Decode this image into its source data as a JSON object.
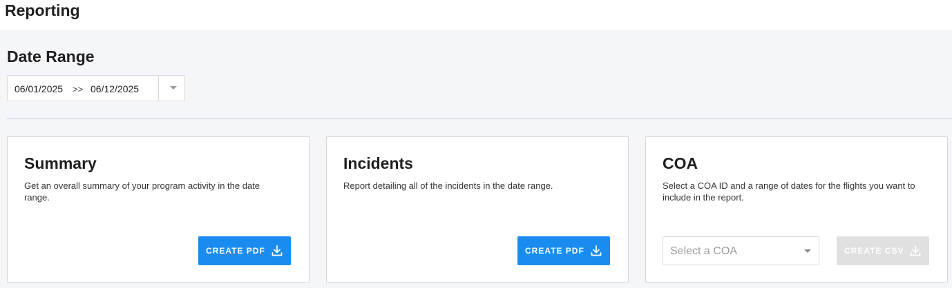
{
  "header": {
    "title": "Reporting"
  },
  "date_range": {
    "title": "Date Range",
    "start": "06/01/2025",
    "separator": ">>",
    "end": "06/12/2025"
  },
  "cards": [
    {
      "title": "Summary",
      "description": "Get an overall summary of your program activity in the date range.",
      "button_label": "CREATE PDF"
    },
    {
      "title": "Incidents",
      "description": "Report detailing all of the incidents in the date range.",
      "button_label": "CREATE PDF"
    },
    {
      "title": "COA",
      "description": "Select a COA ID and a range of dates for the flights you want to include in the report.",
      "select_placeholder": "Select a COA",
      "button_label": "CREATE CSV"
    }
  ],
  "colors": {
    "primary": "#1a8cf0",
    "disabled": "#e0e0e0",
    "background": "#f5f6f9"
  }
}
